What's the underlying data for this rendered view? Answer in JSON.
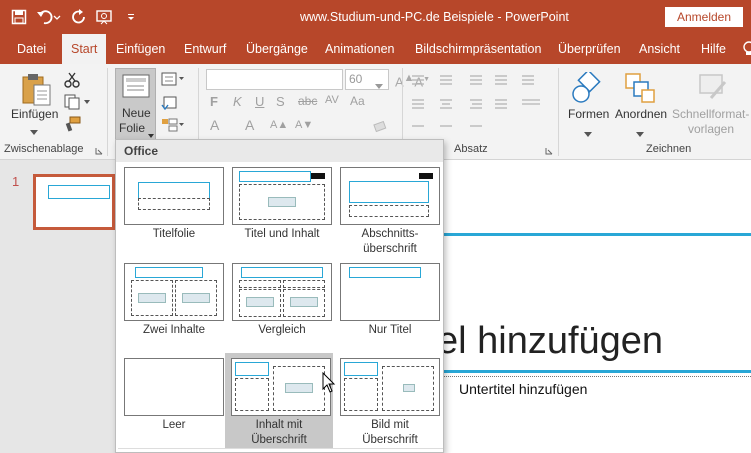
{
  "window": {
    "title": "www.Studium-und-PC.de  Beispiele  -  PowerPoint",
    "signin_label": "Anmelden"
  },
  "qat": {
    "icons": [
      "save-icon",
      "undo-icon",
      "redo-icon",
      "present-icon",
      "customize-icon"
    ]
  },
  "tabs": [
    {
      "label": "Datei"
    },
    {
      "label": "Start",
      "active": true
    },
    {
      "label": "Einfügen"
    },
    {
      "label": "Entwurf"
    },
    {
      "label": "Übergänge"
    },
    {
      "label": "Animationen"
    },
    {
      "label": "Bildschirmpräsentation"
    },
    {
      "label": "Überprüfen"
    },
    {
      "label": "Ansicht"
    },
    {
      "label": "Hilfe"
    }
  ],
  "ribbon": {
    "clipboard": {
      "paste_label": "Einfügen",
      "group_label": "Zwischenablage"
    },
    "slides": {
      "new_slide_line1": "Neue",
      "new_slide_line2": "Folie"
    },
    "font": {
      "font_name": "",
      "font_size": "60",
      "bold": "F",
      "italic": "K",
      "underline": "U",
      "shadow": "S"
    },
    "paragraph": {
      "group_label": "Absatz"
    },
    "drawing": {
      "shapes_label": "Formen",
      "arrange_label": "Anordnen",
      "quickstyles_line1": "Schnellformat-",
      "quickstyles_line2": "vorlagen",
      "group_label": "Zeichnen"
    }
  },
  "gallery": {
    "header": "Office",
    "layouts": [
      {
        "line1": "Titelfolie",
        "line2": ""
      },
      {
        "line1": "Titel und Inhalt",
        "line2": ""
      },
      {
        "line1": "Abschnitts-",
        "line2": "überschrift"
      },
      {
        "line1": "Zwei Inhalte",
        "line2": ""
      },
      {
        "line1": "Vergleich",
        "line2": ""
      },
      {
        "line1": "Nur Titel",
        "line2": ""
      },
      {
        "line1": "Leer",
        "line2": ""
      },
      {
        "line1": "Inhalt mit",
        "line2": "Überschrift",
        "selected": true
      },
      {
        "line1": "Bild mit",
        "line2": "Überschrift"
      }
    ]
  },
  "thumbnails": {
    "slide_number": "1"
  },
  "slide": {
    "title_visible": "el hinzufügen",
    "subtitle": "Untertitel hinzufügen"
  },
  "colors": {
    "accent": "#b7472a",
    "placeholder_line": "#29a7d6"
  }
}
